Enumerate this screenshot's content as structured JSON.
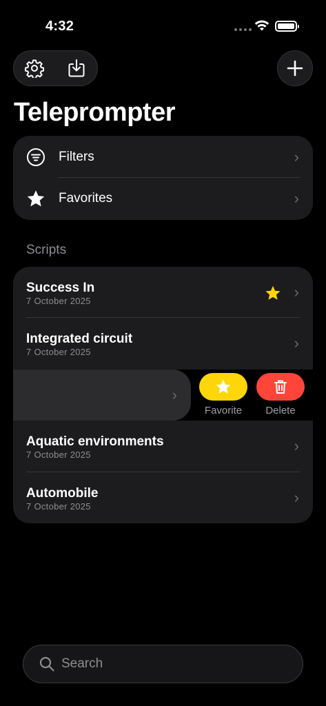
{
  "status": {
    "time": "4:32"
  },
  "toolbar": {
    "settings_icon": "gear-icon",
    "import_icon": "download-icon",
    "add_icon": "plus-icon"
  },
  "page": {
    "title": "Teleprompter"
  },
  "menu": {
    "items": [
      {
        "label": "Filters",
        "icon": "filter-icon"
      },
      {
        "label": "Favorites",
        "icon": "star-icon"
      }
    ]
  },
  "scripts": {
    "section_title": "Scripts",
    "items": [
      {
        "title": "Success In",
        "date": "7 October 2025",
        "favorite": true
      },
      {
        "title": "Integrated circuit",
        "date": "7 October 2025",
        "favorite": false
      },
      {
        "title": "",
        "date": "",
        "favorite": false
      },
      {
        "title": "Aquatic environments",
        "date": "7 October 2025",
        "favorite": false
      },
      {
        "title": "Automobile",
        "date": "7 October 2025",
        "favorite": false
      }
    ]
  },
  "swipe_actions": {
    "favorite_label": "Favorite",
    "delete_label": "Delete",
    "favorite_color": "#FFD60A",
    "delete_color": "#FF453A"
  },
  "search": {
    "placeholder": "Search"
  },
  "colors": {
    "background": "#000000",
    "card": "#1C1C1E",
    "star": "#FFD60A"
  }
}
